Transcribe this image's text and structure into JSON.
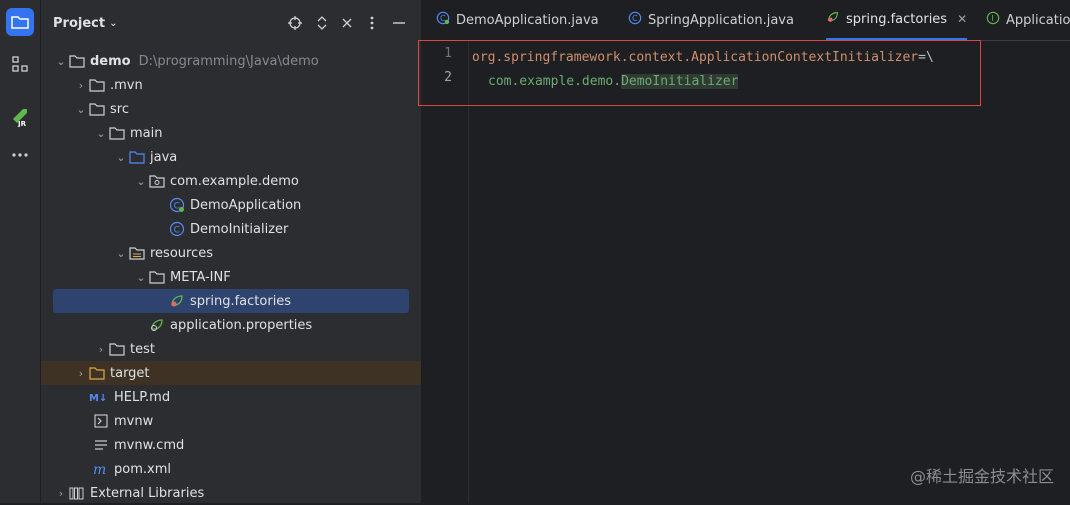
{
  "project_panel": {
    "title": "Project",
    "tree": [
      {
        "label": "demo",
        "path": "D:\\programming\\Java\\demo"
      },
      {
        "label": ".mvn"
      },
      {
        "label": "src"
      },
      {
        "label": "main"
      },
      {
        "label": "java"
      },
      {
        "label": "com.example.demo"
      },
      {
        "label": "DemoApplication"
      },
      {
        "label": "DemoInitializer"
      },
      {
        "label": "resources"
      },
      {
        "label": "META-INF"
      },
      {
        "label": "spring.factories"
      },
      {
        "label": "application.properties"
      },
      {
        "label": "test"
      },
      {
        "label": "target"
      },
      {
        "label": "HELP.md"
      },
      {
        "label": "mvnw"
      },
      {
        "label": "mvnw.cmd"
      },
      {
        "label": "pom.xml"
      },
      {
        "label": "External Libraries"
      }
    ]
  },
  "editor": {
    "tabs": [
      {
        "label": "DemoApplication.java"
      },
      {
        "label": "SpringApplication.java"
      },
      {
        "label": "spring.factories"
      },
      {
        "label": "Application"
      }
    ],
    "line_numbers": [
      "1",
      "2"
    ],
    "code": {
      "line1_key": "org.springframework.context.ApplicationContextInitializer",
      "line1_eq": "=\\",
      "line2_prefix": "com.example.demo.",
      "line2_class": "DemoInitializer"
    }
  },
  "watermark": "@稀土掘金技术社区",
  "colors": {
    "accent": "#3574f0",
    "selection": "#2e436e",
    "highlight_box": "#e0443e"
  }
}
